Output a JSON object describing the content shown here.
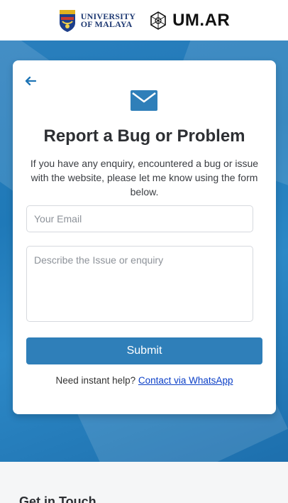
{
  "header": {
    "university_logo_text": [
      "UNIVERSITY",
      "OF MALAYA"
    ],
    "umar_logo_text": "UM.AR"
  },
  "form": {
    "title": "Report a Bug or Problem",
    "description": "If you have any enquiry, encountered a bug or issue with the website, please let me know using the form below.",
    "email_placeholder": "Your Email",
    "issue_placeholder": "Describe the Issue or enquiry",
    "submit_label": "Submit",
    "help_prefix": "Need instant help?",
    "help_link_label": "Contact via WhatsApp"
  },
  "footer": {
    "title": "Get in Touch"
  },
  "colors": {
    "primary": "#2f7fb9",
    "link": "#0b3fc7"
  },
  "icons": {
    "back": "arrow-left-icon",
    "mail": "envelope-icon",
    "university": "crest-icon",
    "umar": "um-ar-icon"
  }
}
